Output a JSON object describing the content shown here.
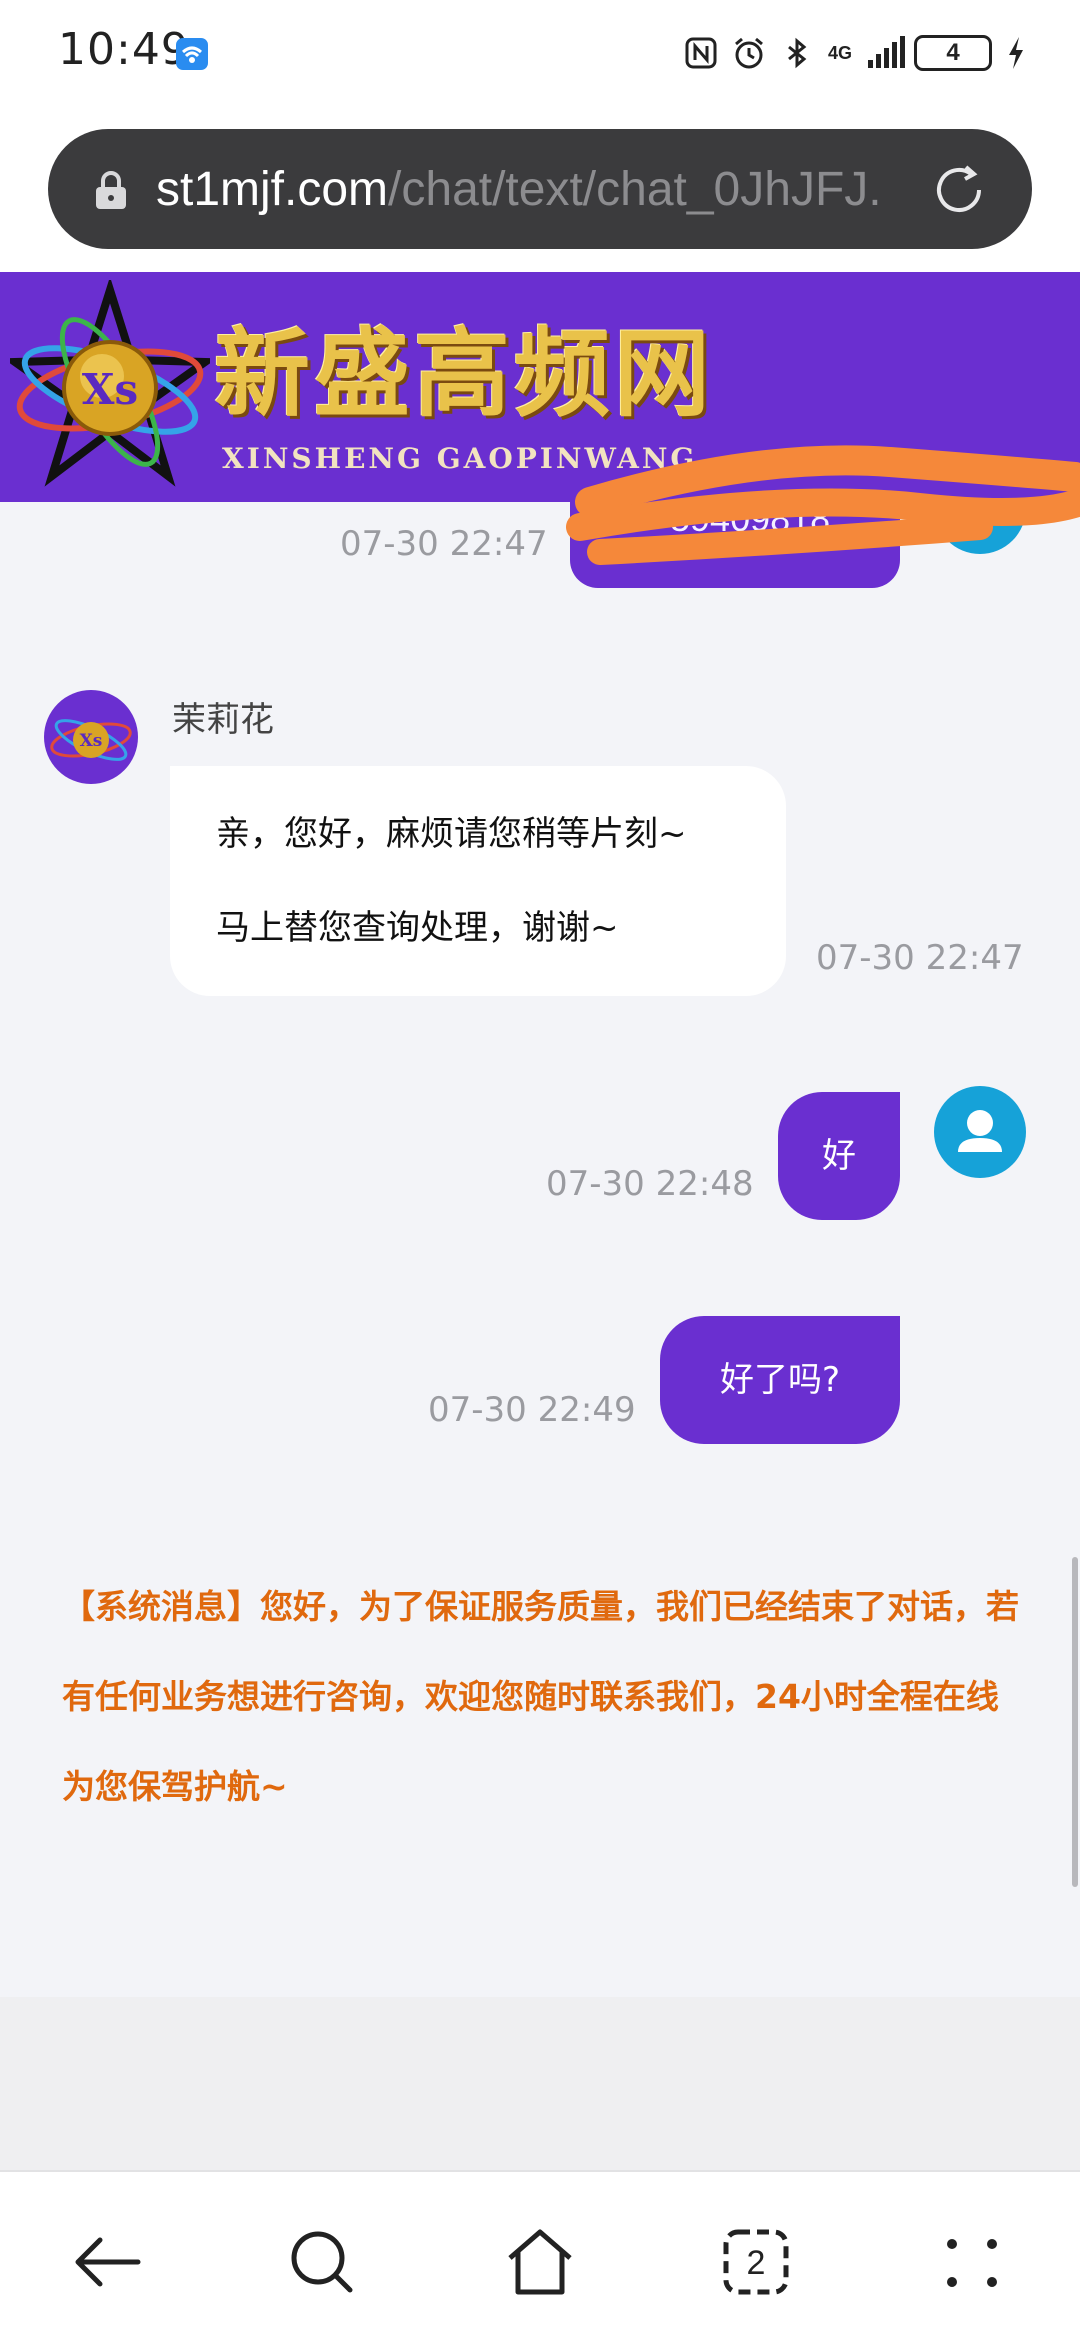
{
  "status_bar": {
    "time": "10:49",
    "network_label": "4G",
    "battery_level": "4"
  },
  "url_bar": {
    "domain": "st1mjf.com",
    "path": "/chat/text/chat_0JhJFJ."
  },
  "site": {
    "title": "新盛高频网",
    "subtitle": "XINSHENG GAOPINWANG",
    "logo_text": "Xs"
  },
  "chat": {
    "partial_message": {
      "time": "07-30 22:47",
      "text": "59409818"
    },
    "agent_message": {
      "sender": "茉莉花",
      "lines": [
        "亲，您好，麻烦请您稍等片刻~",
        "马上替您查询处理，谢谢~"
      ],
      "time": "07-30 22:47"
    },
    "user_messages": [
      {
        "text": "好",
        "time": "07-30 22:48"
      },
      {
        "text": "好了吗?",
        "time": "07-30 22:49"
      }
    ],
    "system_message": "【系统消息】您好，为了保证服务质量，我们已经结束了对话，若有任何业务想进行咨询，欢迎您随时联系我们，24小时全程在线为您保驾护航~"
  },
  "bottom_nav": {
    "tab_count": "2"
  },
  "colors": {
    "brand_purple": "#6a2fd0",
    "user_avatar": "#16a2d8",
    "system_text": "#e0690e",
    "scribble": "#f5883a"
  }
}
